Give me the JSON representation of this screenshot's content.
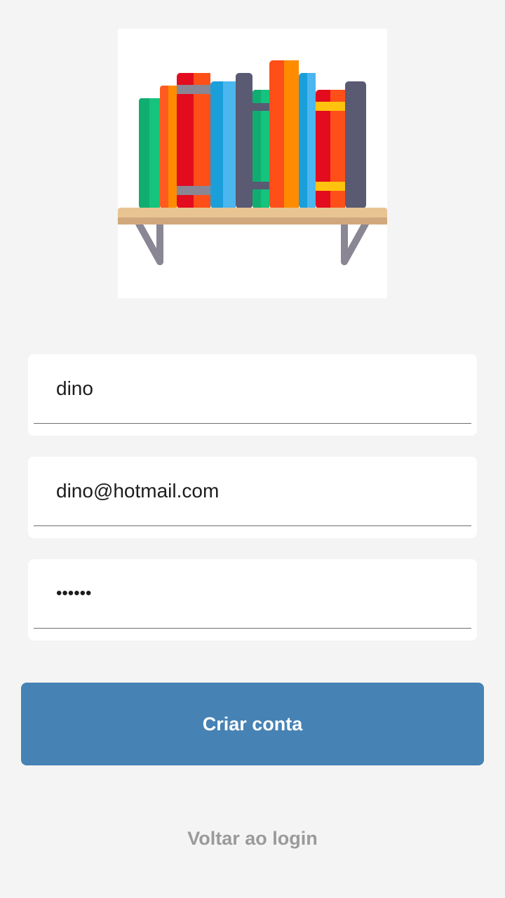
{
  "logo": {
    "icon": "bookshelf-icon"
  },
  "form": {
    "username": {
      "value": "dino"
    },
    "email": {
      "value": "dino@hotmail.com"
    },
    "password": {
      "value": "••••••"
    }
  },
  "actions": {
    "create_account_label": "Criar conta",
    "back_to_login_label": "Voltar ao login"
  },
  "colors": {
    "background": "#f4f4f4",
    "primary": "#4682b4",
    "link": "#9a9a9a"
  }
}
